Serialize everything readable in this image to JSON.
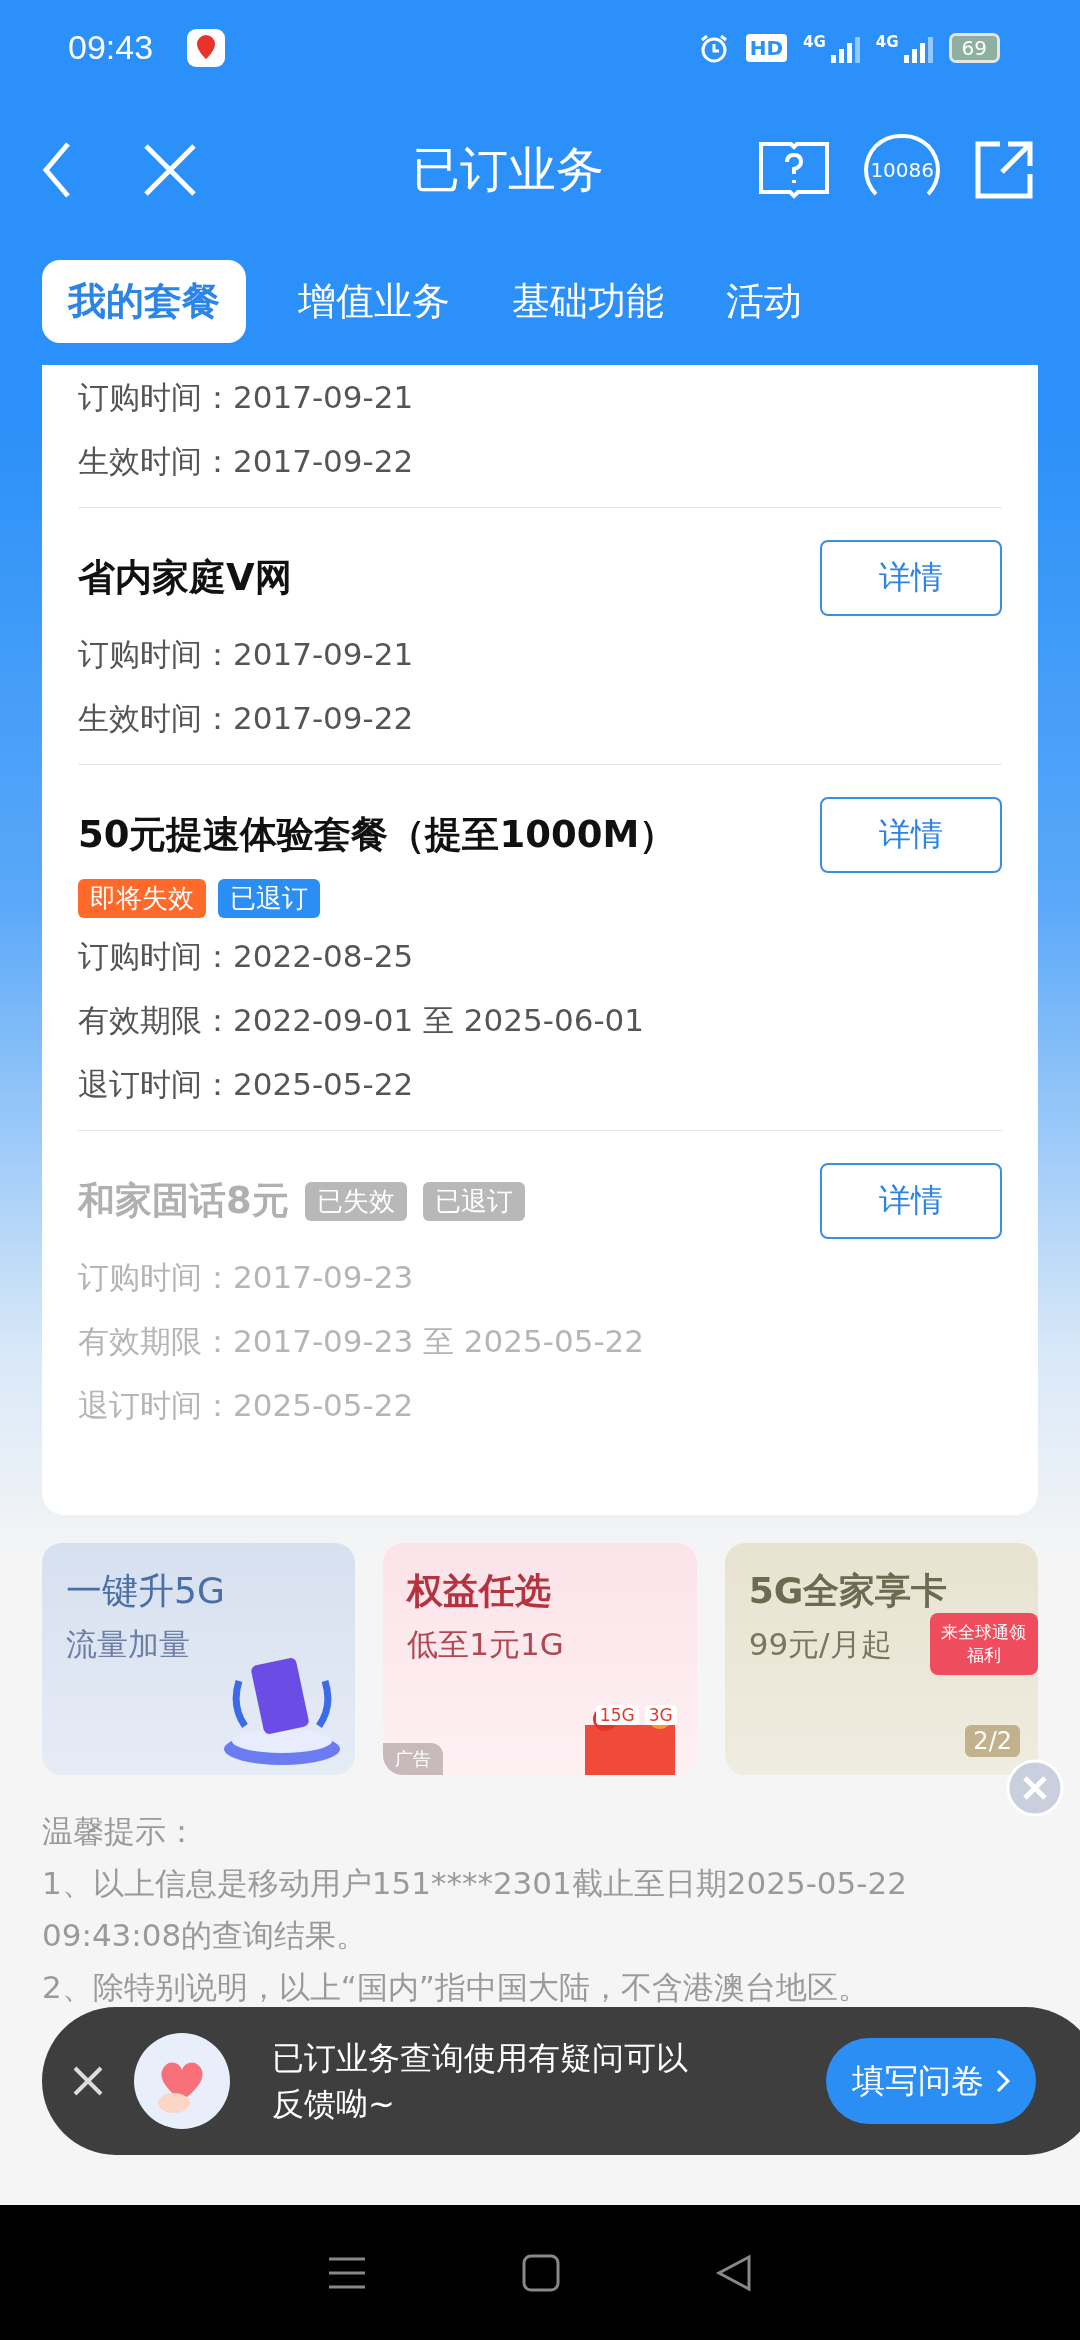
{
  "status_bar": {
    "time": "09:43",
    "hd": "HD",
    "sim1": "4G",
    "sim2": "4G",
    "battery": "69"
  },
  "header": {
    "title": "已订业务",
    "hotline": "10086"
  },
  "tabs": [
    {
      "label": "我的套餐",
      "selected": true
    },
    {
      "label": "增值业务",
      "selected": false
    },
    {
      "label": "基础功能",
      "selected": false
    },
    {
      "label": "活动",
      "selected": false
    }
  ],
  "products": [
    {
      "disabled": false,
      "fields": [
        {
          "label": "订购时间：",
          "value": "2017-09-21"
        },
        {
          "label": "生效时间：",
          "value": "2017-09-22"
        }
      ]
    },
    {
      "name": "省内家庭V网",
      "disabled": false,
      "button": "详情",
      "fields": [
        {
          "label": "订购时间：",
          "value": "2017-09-21"
        },
        {
          "label": "生效时间：",
          "value": "2017-09-22"
        }
      ]
    },
    {
      "name": "50元提速体验套餐（提至1000M）",
      "disabled": false,
      "button": "详情",
      "tags": [
        {
          "text": "即将失效",
          "color": "#ff6a2b"
        },
        {
          "text": "已退订",
          "color": "#2b8ef5"
        }
      ],
      "fields": [
        {
          "label": "订购时间：",
          "value": "2022-08-25"
        },
        {
          "label": "有效期限：",
          "value": "2022-09-01 至 2025-06-01"
        },
        {
          "label": "退订时间：",
          "value": "2025-05-22"
        }
      ]
    },
    {
      "name": "和家固话8元",
      "disabled": true,
      "button": "详情",
      "tags": [
        {
          "text": "已失效",
          "color": "#b8b8b8"
        },
        {
          "text": "已退订",
          "color": "#b8b8b8"
        }
      ],
      "fields": [
        {
          "label": "订购时间：",
          "value": "2017-09-23"
        },
        {
          "label": "有效期限：",
          "value": "2017-09-23 至 2025-05-22"
        },
        {
          "label": "退订时间：",
          "value": "2025-05-22"
        }
      ]
    }
  ],
  "banners": [
    {
      "title": "一键升5G",
      "subtitle": "流量加量"
    },
    {
      "title": "权益任选",
      "subtitle": "低至1元1G",
      "ad": "广告",
      "stickers": [
        "15G",
        "3G"
      ]
    },
    {
      "title": "5G全家享卡",
      "subtitle": "99元/月起",
      "gift": "来全球通领福利",
      "pager": "2/2"
    }
  ],
  "tips": {
    "title": "温馨提示：",
    "lines": [
      "1、以上信息是移动用户151****2301截止至日期2025-05-22 09:43:08的查询结果。",
      "2、除特别说明，以上“国内”指中国大陆，不含港澳台地区。"
    ]
  },
  "toast": {
    "message": "已订业务查询使用有疑问可以反馈呦~",
    "button": "填写问卷"
  }
}
